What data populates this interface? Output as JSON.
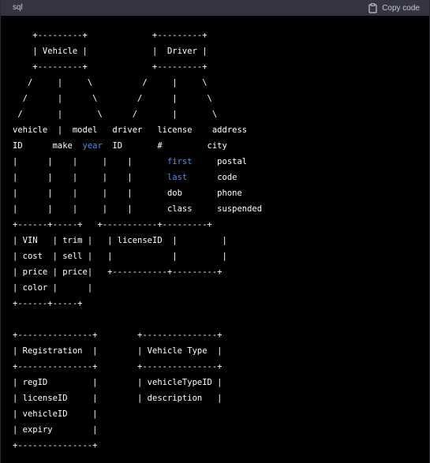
{
  "header": {
    "language": "sql",
    "copy_label": "Copy code"
  },
  "colors": {
    "header_bg": "#343541",
    "code_bg": "#000000",
    "text": "#ffffff",
    "keyword_blue": "#4d8fe0"
  },
  "code_lines": [
    [
      {
        "t": "    +---------+             +---------+"
      }
    ],
    [
      {
        "t": "    | Vehicle |             |  Driver |"
      }
    ],
    [
      {
        "t": "    +---------+             +---------+"
      }
    ],
    [
      {
        "t": "   /     |     \\          /     |     \\"
      }
    ],
    [
      {
        "t": "  /      |      \\        /      |      \\"
      }
    ],
    [
      {
        "t": " /       |       \\      /       |       \\"
      }
    ],
    [
      {
        "t": "vehicle  |  model   driver   license    address"
      }
    ],
    [
      {
        "t": "ID      make  "
      },
      {
        "t": "year",
        "c": "blue"
      },
      {
        "t": "  ID       #         city"
      }
    ],
    [
      {
        "t": "|      |    |     |    |       "
      },
      {
        "t": "first",
        "c": "blue"
      },
      {
        "t": "     postal"
      }
    ],
    [
      {
        "t": "|      |    |     |    |       "
      },
      {
        "t": "last",
        "c": "blue"
      },
      {
        "t": "      code"
      }
    ],
    [
      {
        "t": "|      |    |     |    |       dob       phone"
      }
    ],
    [
      {
        "t": "|      |    |     |    |       class     suspended"
      }
    ],
    [
      {
        "t": "+------+-----+   +-----------+---------+"
      }
    ],
    [
      {
        "t": "| VIN   | trim |   | licenseID  |         |"
      }
    ],
    [
      {
        "t": "| cost  | sell |   |            |         |"
      }
    ],
    [
      {
        "t": "| price | price|   +-----------+---------+"
      }
    ],
    [
      {
        "t": "| color |      |"
      }
    ],
    [
      {
        "t": "+------+-----+"
      }
    ],
    [
      {
        "t": ""
      }
    ],
    [
      {
        "t": "+---------------+        +---------------+"
      }
    ],
    [
      {
        "t": "| Registration  |        | Vehicle Type  |"
      }
    ],
    [
      {
        "t": "+---------------+        +---------------+"
      }
    ],
    [
      {
        "t": "| regID         |        | vehicleTypeID |"
      }
    ],
    [
      {
        "t": "| licenseID     |        | description   |"
      }
    ],
    [
      {
        "t": "| vehicleID     |"
      }
    ],
    [
      {
        "t": "| expiry        |"
      }
    ],
    [
      {
        "t": "+---------------+"
      }
    ]
  ]
}
